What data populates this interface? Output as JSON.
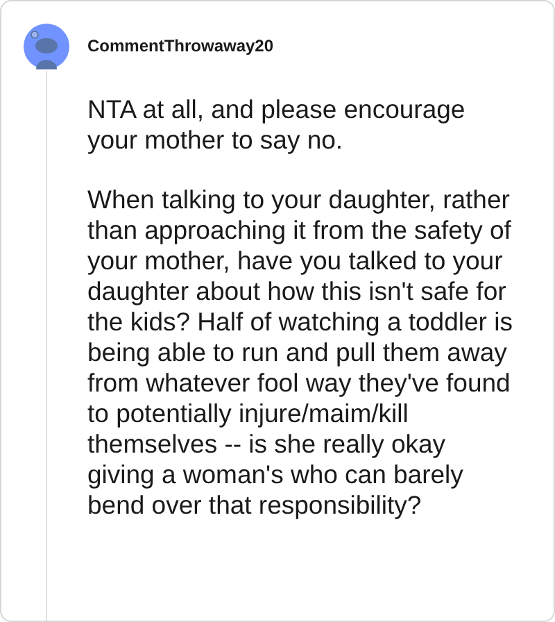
{
  "comment": {
    "username": "CommentThrowaway20",
    "paragraphs": [
      "NTA at all, and please encourage your mother to say no.",
      "When talking to your daughter, rather than approaching it from the safety of your mother, have you talked to your daughter about how this isn't safe for the kids? Half of watching a toddler is being able to run and pull them away from whatever fool way they've found to potentially injure/maim/kill themselves -- is she really okay giving a woman's who can barely bend over that responsibility?"
    ]
  }
}
